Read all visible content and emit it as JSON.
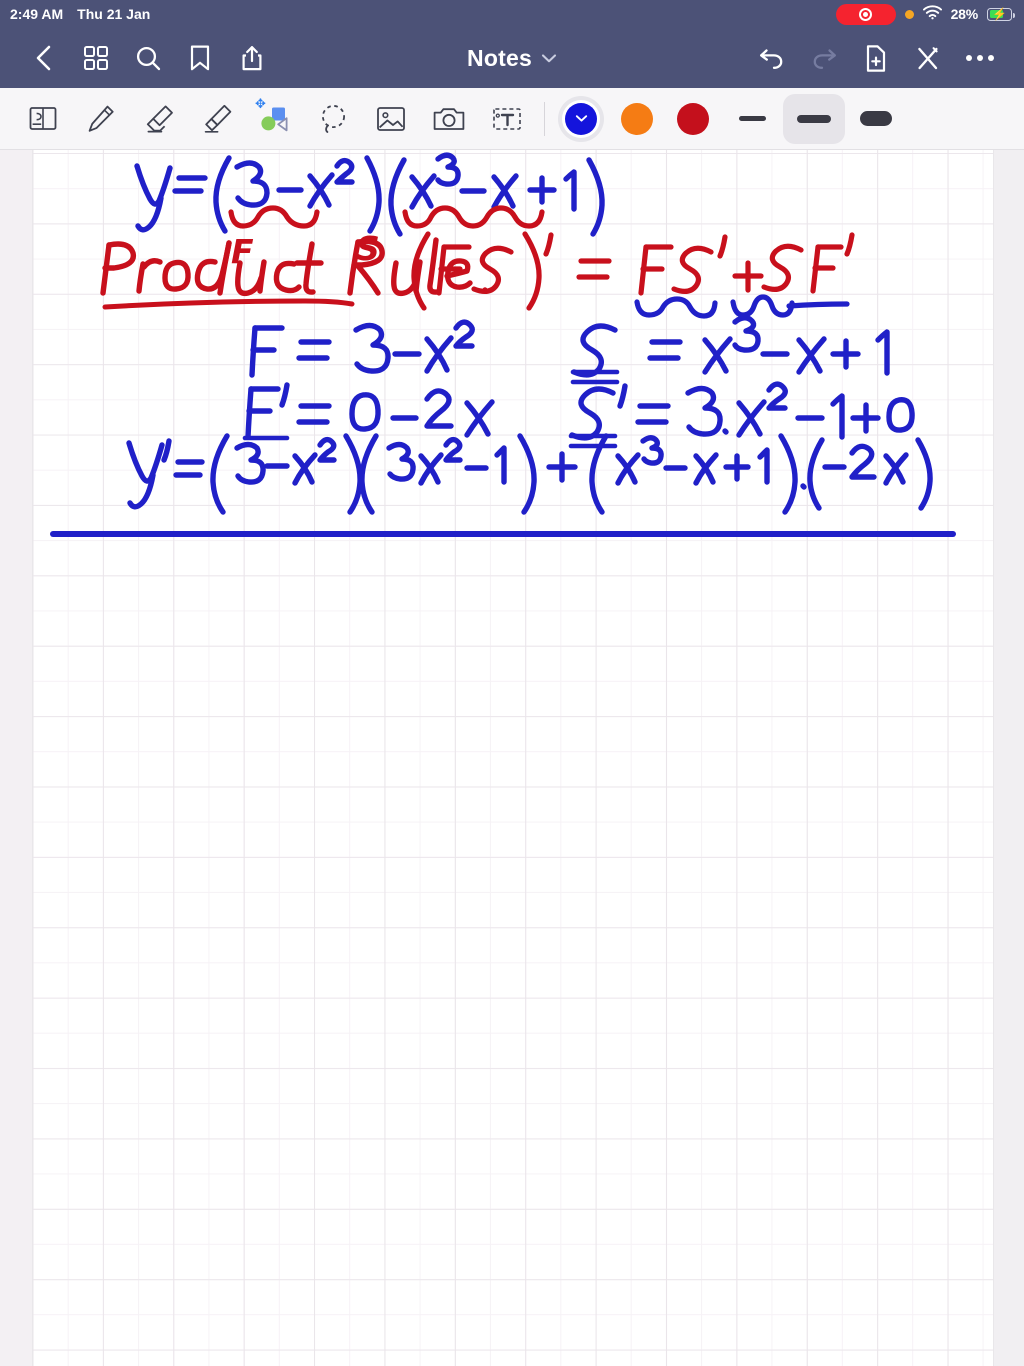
{
  "status_bar": {
    "time": "2:49 AM",
    "date": "Thu 21 Jan",
    "battery_percent": "28%",
    "icons": {
      "recording": "screen-recording-pill",
      "orange_dot": "microphone-in-use-dot",
      "wifi": "wifi-icon",
      "battery": "battery-charging-icon"
    },
    "colors": {
      "bar_background": "#4c5277",
      "recording_red": "#f5232f",
      "orange": "#f5a623",
      "battery_green": "#3ddc54"
    }
  },
  "nav_bar": {
    "title": "Notes",
    "title_chevron": "chevron-down-icon",
    "left_items": [
      {
        "name": "back-button",
        "icon": "chevron-left-icon"
      },
      {
        "name": "page-thumbnails-button",
        "icon": "grid-four-squares-icon"
      },
      {
        "name": "search-button",
        "icon": "search-icon"
      },
      {
        "name": "bookmark-button",
        "icon": "bookmark-icon"
      },
      {
        "name": "share-button",
        "icon": "share-upload-icon"
      }
    ],
    "right_items": [
      {
        "name": "undo-button",
        "icon": "undo-arrow-icon",
        "state": "enabled"
      },
      {
        "name": "redo-button",
        "icon": "redo-arrow-icon",
        "state": "disabled"
      },
      {
        "name": "add-page-button",
        "icon": "document-plus-icon"
      },
      {
        "name": "close-button",
        "icon": "close-x-icon"
      },
      {
        "name": "more-button",
        "icon": "ellipsis-icon"
      }
    ]
  },
  "toolbar": {
    "tools": [
      {
        "name": "page-layout-tool",
        "icon": "page-flip-icon"
      },
      {
        "name": "pen-tool",
        "icon": "pencil-icon"
      },
      {
        "name": "eraser-tool",
        "icon": "eraser-icon"
      },
      {
        "name": "highlighter-tool",
        "icon": "highlighter-icon"
      },
      {
        "name": "shapes-tool",
        "icon": "shapes-icon",
        "badge": "bluetooth-icon"
      },
      {
        "name": "lasso-select-tool",
        "icon": "lasso-dashed-circle-icon"
      },
      {
        "name": "insert-image-tool",
        "icon": "photo-icon"
      },
      {
        "name": "camera-tool",
        "icon": "camera-icon"
      },
      {
        "name": "text-tool",
        "icon": "text-box-icon"
      }
    ],
    "colors": [
      {
        "name": "color-swatch-blue",
        "hex": "#1414dc",
        "selected": true,
        "chevron": "chevron-down-icon"
      },
      {
        "name": "color-swatch-orange",
        "hex": "#f57c14",
        "selected": false
      },
      {
        "name": "color-swatch-red",
        "hex": "#c4101c",
        "selected": false
      }
    ],
    "stroke_widths": [
      {
        "name": "stroke-width-thin",
        "label": "thin",
        "selected": false
      },
      {
        "name": "stroke-width-medium",
        "label": "medium",
        "selected": true
      },
      {
        "name": "stroke-width-thick",
        "label": "thick",
        "selected": false
      }
    ],
    "background": "#f7f6f8"
  },
  "note": {
    "paper": "grid-paper",
    "ink_colors": {
      "blue": "#2020c8",
      "red": "#c8101c"
    },
    "lines": [
      {
        "id": "line-1",
        "color": "blue",
        "text": "y = (3 - x²) (x³ - x + 1)"
      },
      {
        "id": "brace-F",
        "color": "red",
        "text": "F",
        "note": "underbrace under (3 - x²)"
      },
      {
        "id": "brace-S",
        "color": "red",
        "text": "S",
        "note": "underbrace under (x³ - x + 1)"
      },
      {
        "id": "line-2",
        "color": "red",
        "text": "Product Rule.",
        "underlined": true
      },
      {
        "id": "line-3",
        "color": "red",
        "text": "(FS)' = FS' + SF'",
        "note": "blue underbraces beneath FS' and SF'"
      },
      {
        "id": "line-4a",
        "color": "blue",
        "text": "F = 3 - x²"
      },
      {
        "id": "line-4b",
        "color": "blue",
        "text": "S = x³ - x + 1",
        "note": "S double underlined"
      },
      {
        "id": "line-5a",
        "color": "blue",
        "text": "F' = 0 - 2x",
        "note": "F' underlined"
      },
      {
        "id": "line-5b",
        "color": "blue",
        "text": "S' = 3·x² - 1 + 0",
        "note": "S' double underlined"
      },
      {
        "id": "line-6",
        "color": "blue",
        "text": "y' = (3 - x²) (3x² - 1) + (x³ - x + 1).(-2x)"
      },
      {
        "id": "divider",
        "color": "blue",
        "text": "",
        "note": "horizontal ruled separator line"
      }
    ]
  }
}
